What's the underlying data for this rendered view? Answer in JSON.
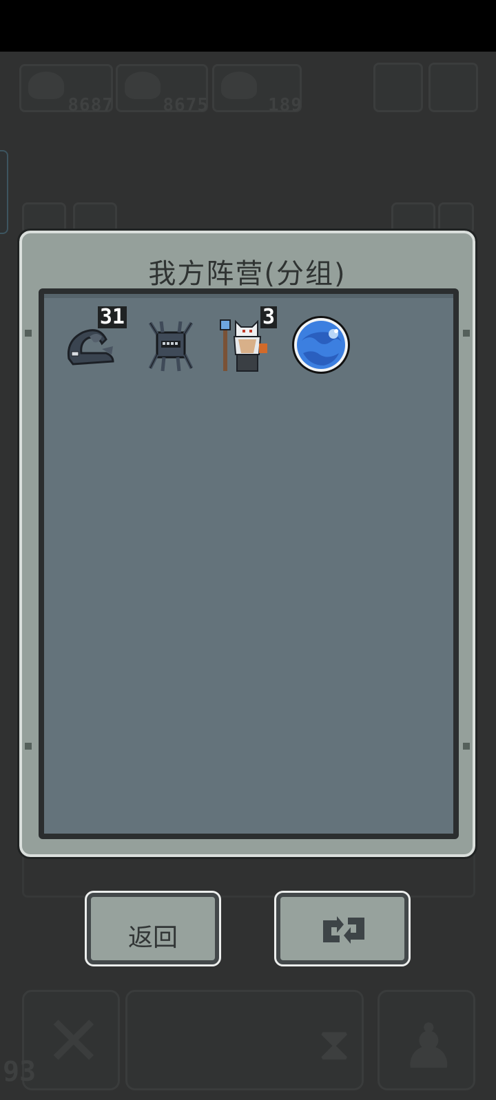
{
  "hud": {
    "resources": [
      {
        "icon": "resource-icon",
        "value": "8687"
      },
      {
        "icon": "resource-icon",
        "value": "8675"
      },
      {
        "icon": "resource-icon",
        "value": "189"
      }
    ],
    "bottom_counter": "93"
  },
  "dialog": {
    "title": "我方阵营(分组)",
    "units": [
      {
        "name": "dark-slug-unit",
        "count": "31"
      },
      {
        "name": "mech-spider-unit",
        "count": ""
      },
      {
        "name": "white-wizard-unit",
        "count": "3"
      },
      {
        "name": "blue-orb-unit",
        "count": ""
      }
    ]
  },
  "buttons": {
    "back_label": "返回",
    "swap_icon": "swap-arrows-icon"
  },
  "colors": {
    "panel": "#95a09b",
    "inner": "#64737b",
    "button": "#97a29d"
  }
}
